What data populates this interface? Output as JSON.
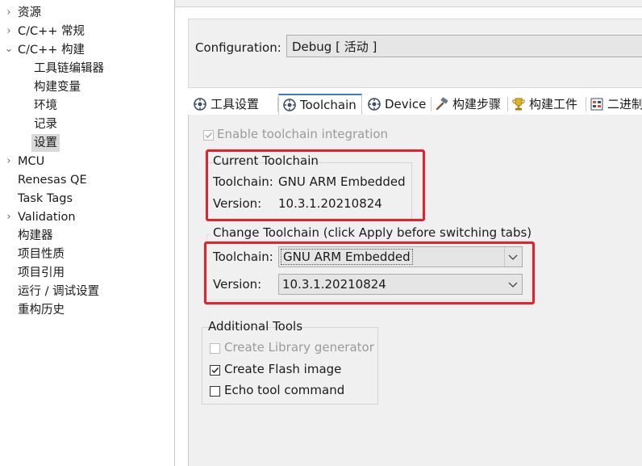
{
  "tree": {
    "items": [
      {
        "label": "资源",
        "expandable": true
      },
      {
        "label": "C/C++ 常规",
        "expandable": true
      },
      {
        "label": "C/C++ 构建",
        "expanded": true
      },
      {
        "label": "工具链编辑器"
      },
      {
        "label": "构建变量"
      },
      {
        "label": "环境"
      },
      {
        "label": "记录"
      },
      {
        "label": "设置",
        "selected": true
      },
      {
        "label": "MCU",
        "expandable": true
      },
      {
        "label": "Renesas QE"
      },
      {
        "label": "Task Tags"
      },
      {
        "label": "Validation",
        "expandable": true
      },
      {
        "label": "构建器"
      },
      {
        "label": "项目性质"
      },
      {
        "label": "项目引用"
      },
      {
        "label": "运行 / 调试设置"
      },
      {
        "label": "重构历史"
      }
    ]
  },
  "config": {
    "label": "Configuration:",
    "value": "Debug  [ 活动 ]"
  },
  "tabs": [
    {
      "label": "工具设置",
      "icon": "gear-icon"
    },
    {
      "label": "Toolchain",
      "icon": "gear-icon",
      "active": true
    },
    {
      "label": "Device",
      "icon": "gear-icon"
    },
    {
      "label": "构建步骤",
      "icon": "hammer-icon"
    },
    {
      "label": "构建工件",
      "icon": "trophy-icon"
    },
    {
      "label": "二进制解",
      "icon": "binary-icon"
    }
  ],
  "toolchain_tab": {
    "enable_integration": {
      "label": "Enable toolchain integration",
      "checked": true,
      "disabled": true
    },
    "current": {
      "title": "Current Toolchain",
      "toolchain_label": "Toolchain:",
      "toolchain_value": "GNU ARM Embedded",
      "version_label": "Version:",
      "version_value": "10.3.1.20210824"
    },
    "change": {
      "title": "Change Toolchain (click Apply before switching tabs)",
      "toolchain_label": "Toolchain:",
      "toolchain_selected": "GNU ARM Embedded",
      "version_label": "Version:",
      "version_selected": "10.3.1.20210824"
    },
    "additional": {
      "title": "Additional Tools",
      "library_generator": {
        "label": "Create Library generator",
        "checked": false,
        "disabled": true
      },
      "flash_image": {
        "label": "Create Flash image",
        "checked": true
      },
      "echo_command": {
        "label": "Echo tool command",
        "checked": false
      }
    }
  },
  "colors": {
    "highlight": "#e8202a",
    "tab_accent": "#3a7bd5"
  }
}
